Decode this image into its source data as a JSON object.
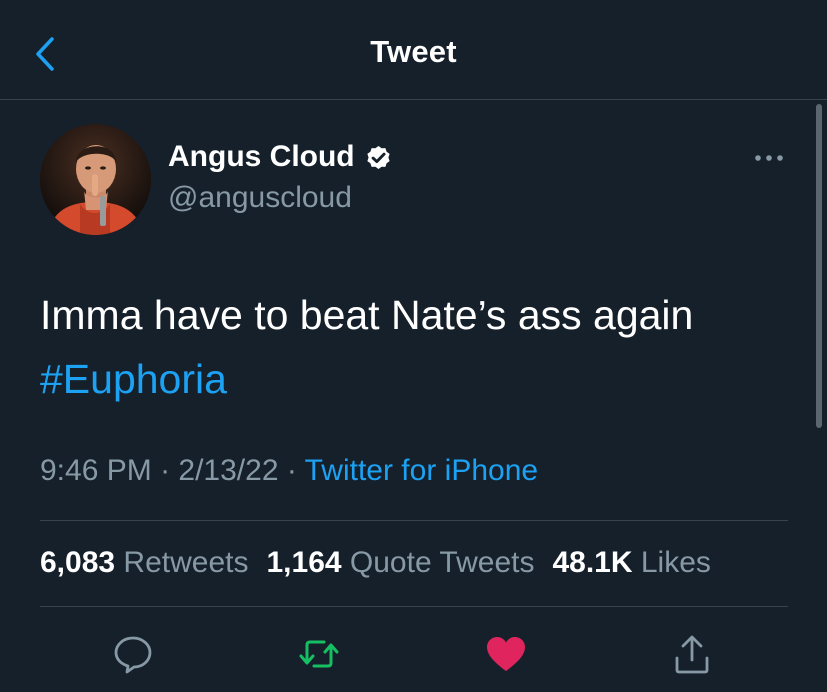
{
  "header": {
    "title": "Tweet",
    "back_icon": "chevron-left-icon"
  },
  "author": {
    "display_name": "Angus Cloud",
    "handle": "@anguscloud",
    "verified_icon": "verified-badge-icon"
  },
  "tweet": {
    "text": "Imma have to beat Nate’s ass again",
    "hashtag": "#Euphoria",
    "time": "9:46 PM",
    "separator": " · ",
    "date": "2/13/22",
    "source": "Twitter for iPhone"
  },
  "stats": {
    "retweets_count": "6,083",
    "retweets_label": "Retweets",
    "quotes_count": "1,164",
    "quotes_label": "Quote Tweets",
    "likes_count": "48.1K",
    "likes_label": "Likes"
  },
  "actions": {
    "reply_icon": "reply-icon",
    "retweet_icon": "retweet-icon",
    "like_icon": "heart-icon",
    "share_icon": "share-icon"
  },
  "colors": {
    "background": "#15202b",
    "accent": "#1da1f2",
    "muted": "#8899a6",
    "retweet": "#17bf63",
    "like": "#e0245e",
    "divider": "#38444d"
  }
}
